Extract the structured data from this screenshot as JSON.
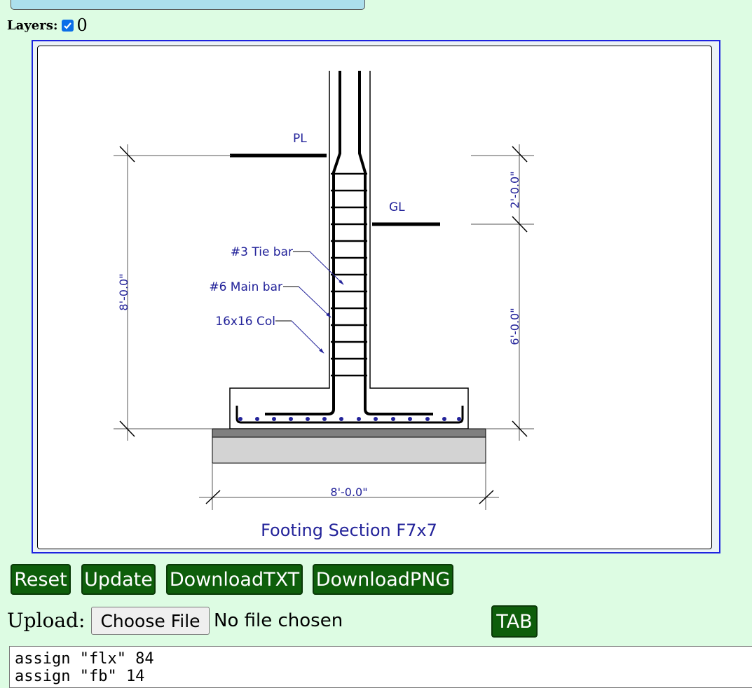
{
  "layers": {
    "label": "Layers:",
    "checked": true,
    "value": "0"
  },
  "drawing": {
    "title": "Footing Section F7x7",
    "labels": {
      "pl": "PL",
      "gl": "GL",
      "tie_bar": "#3 Tie bar",
      "main_bar": "#6 Main bar",
      "column": "16x16 Col"
    },
    "dimensions": {
      "left_height": "8'-0.0\"",
      "right_upper": "2'-0.0\"",
      "right_lower": "6'-0.0\"",
      "bottom_width": "8'-0.0\""
    },
    "colors": {
      "annotation": "#23239a",
      "line": "#000000",
      "dim_line": "#555555",
      "slab_dark": "#7f7f7f",
      "slab_light": "#d3d3d3"
    }
  },
  "toolbar": {
    "reset": "Reset",
    "update": "Update",
    "download_txt": "DownloadTXT",
    "download_png": "DownloadPNG",
    "tab": "TAB"
  },
  "upload": {
    "label": "Upload:",
    "button": "Choose File",
    "status": "No file chosen"
  },
  "script_lines": [
    "assign \"flx\" 84",
    "assign \"fb\" 14"
  ],
  "colors": {
    "background": "#ddfce3",
    "button_bg": "#0e5e0b",
    "frame_border": "#1d23e0",
    "top_box": "#acdfec"
  }
}
